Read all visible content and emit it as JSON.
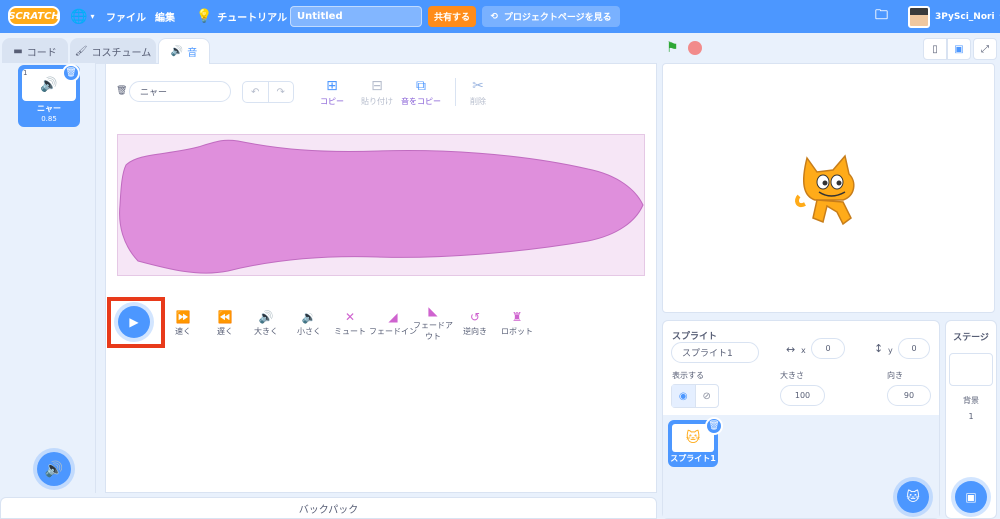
{
  "menu": {
    "logo": "SCRATCH",
    "file": "ファイル",
    "edit": "編集",
    "tutorials": "チュートリアル",
    "project_title": "Untitled",
    "share": "共有する",
    "see_project_page": "プロジェクトページを見る",
    "username": "3PySci_Nori"
  },
  "tabs": {
    "code": "コード",
    "costumes": "コスチューム",
    "sounds": "音"
  },
  "sound_list": {
    "items": [
      {
        "index": "1",
        "name": "ニャー",
        "duration": "0.85"
      }
    ]
  },
  "editor": {
    "sound_name": "ニャー",
    "tools": {
      "copy": "コピー",
      "paste": "貼り付け",
      "copy_to_new": "音をコピー",
      "delete": "削除"
    },
    "effects": [
      {
        "label": "速く",
        "icon": "faster-icon"
      },
      {
        "label": "遅く",
        "icon": "slower-icon"
      },
      {
        "label": "大きく",
        "icon": "louder-icon"
      },
      {
        "label": "小さく",
        "icon": "softer-icon"
      },
      {
        "label": "ミュート",
        "icon": "mute-icon"
      },
      {
        "label": "フェードイン",
        "icon": "fade-in-icon"
      },
      {
        "label": "フェードアウト",
        "icon": "fade-out-icon"
      },
      {
        "label": "逆向き",
        "icon": "reverse-icon"
      },
      {
        "label": "ロボット",
        "icon": "robot-icon"
      }
    ]
  },
  "backpack": "バックパック",
  "sprite_info": {
    "label": "スプライト",
    "name": "スプライト1",
    "x_label": "x",
    "x": "0",
    "y_label": "y",
    "y": "0",
    "show_label": "表示する",
    "size_label": "大きさ",
    "size": "100",
    "direction_label": "向き",
    "direction": "90"
  },
  "sprites": [
    {
      "name": "スプライト1"
    }
  ],
  "stage_panel": {
    "title": "ステージ",
    "backdrops_label": "背景",
    "backdrops_count": "1"
  },
  "colors": {
    "primary": "#4c97ff",
    "menu_bar": "#4c97ff",
    "share": "#ff8c1a",
    "waveform": "#d98fd9",
    "highlight": "#e83a1a"
  }
}
